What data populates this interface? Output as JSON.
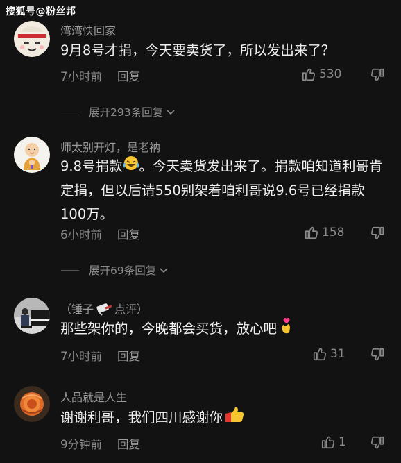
{
  "watermark": "搜狐号@粉丝邦",
  "comments": [
    {
      "username": "湾湾快回家",
      "text": "9月8号才捐，今天要卖货了，所以发出来了？",
      "time": "7小时前",
      "reply_label": "回复",
      "likes": "530",
      "expand_label": "展开293条回复"
    },
    {
      "username": "师太别开灯，是老衲",
      "text_part1": "9.8号捐款",
      "text_part2": "。今天卖货发出来了。捐款咱知道利哥肯定捐，但以后请550别架着咱利哥说9.6号已经捐款100万。",
      "time": "6小时前",
      "reply_label": "回复",
      "likes": "158",
      "expand_label": "展开69条回复"
    },
    {
      "username_part1": "（锤子",
      "username_part2": "点评）",
      "text": "那些架你的，今晚都会买货，放心吧",
      "time": "7小时前",
      "reply_label": "回复",
      "likes": "31"
    },
    {
      "username": "人品就是人生",
      "text": "谢谢利哥，我们四川感谢你",
      "time": "9分钟前",
      "reply_label": "回复",
      "likes": "1"
    }
  ]
}
